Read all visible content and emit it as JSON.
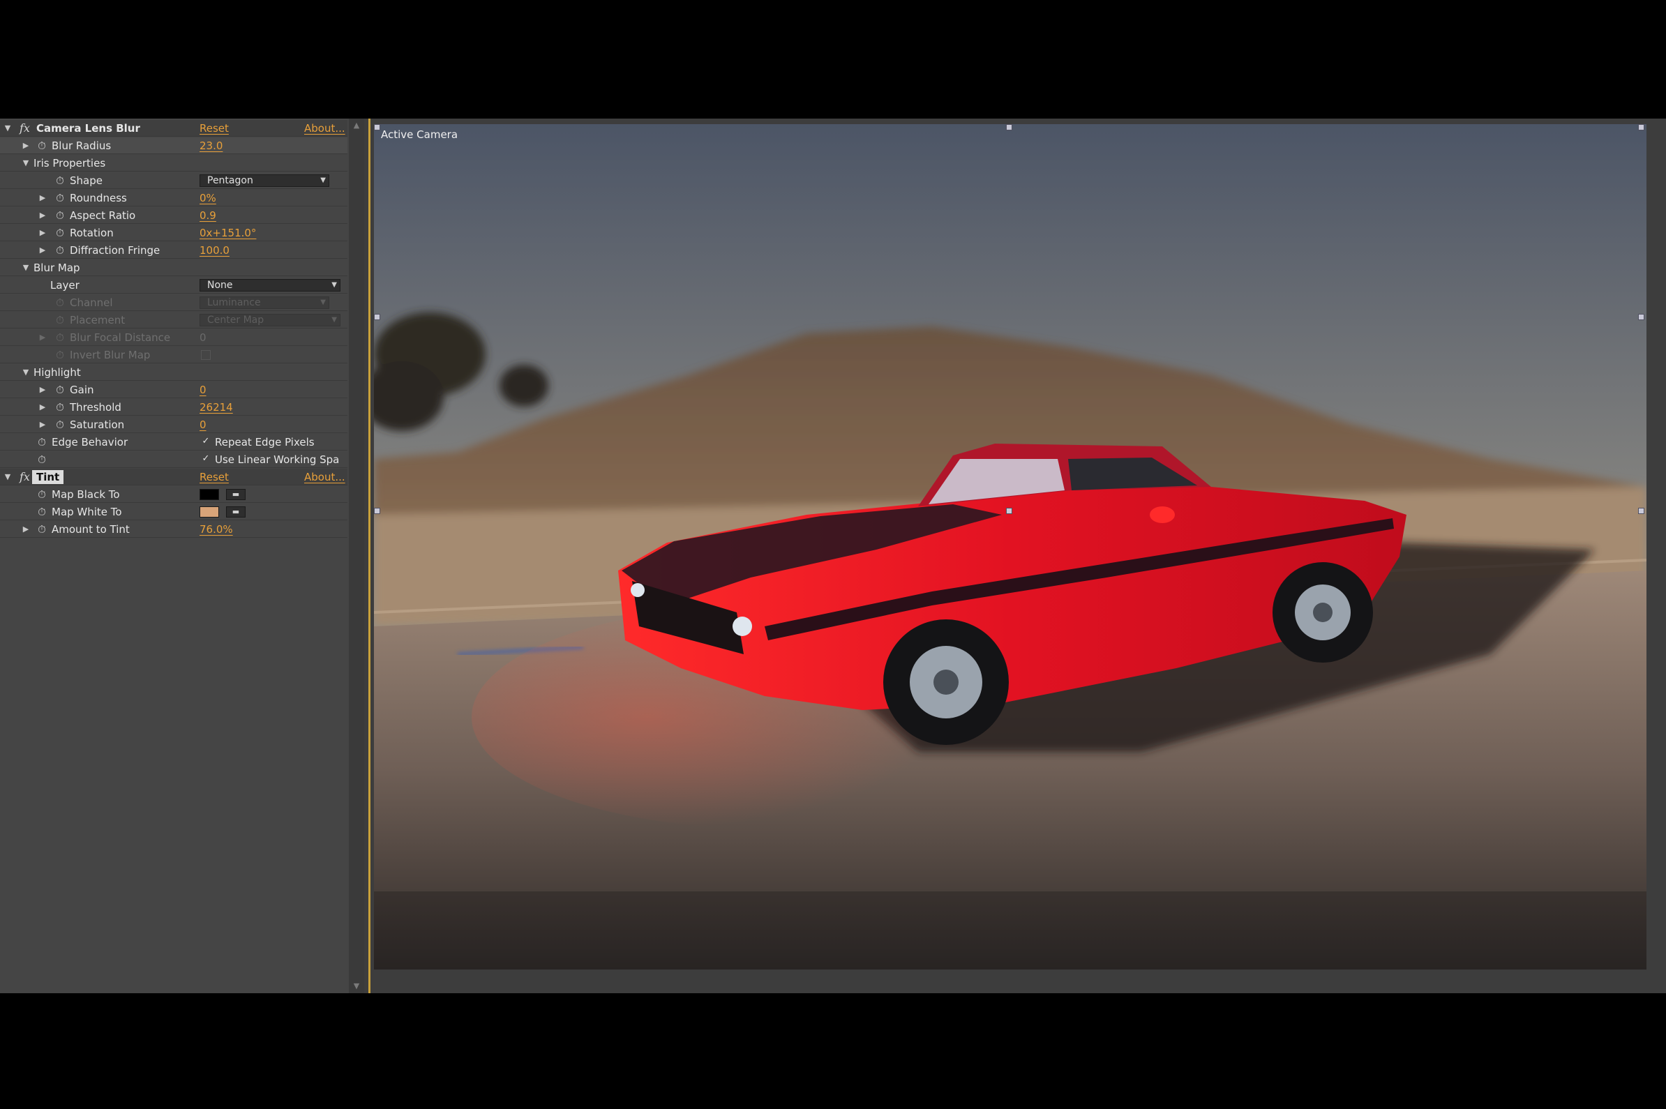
{
  "effects_panel": {
    "camera_lens_blur": {
      "fx_glyph": "fx",
      "name": "Camera Lens Blur",
      "reset": "Reset",
      "about": "About...",
      "blur_radius": {
        "label": "Blur Radius",
        "value": "23.0"
      },
      "iris_properties": {
        "label": "Iris Properties"
      },
      "shape": {
        "label": "Shape",
        "value": "Pentagon"
      },
      "roundness": {
        "label": "Roundness",
        "value": "0%"
      },
      "aspect_ratio": {
        "label": "Aspect Ratio",
        "value": "0.9"
      },
      "rotation": {
        "label": "Rotation",
        "value": "0x+151.0°"
      },
      "diffraction_fringe": {
        "label": "Diffraction Fringe",
        "value": "100.0"
      },
      "blur_map": {
        "label": "Blur Map"
      },
      "layer": {
        "label": "Layer",
        "value": "None"
      },
      "channel": {
        "label": "Channel",
        "value": "Luminance"
      },
      "placement": {
        "label": "Placement",
        "value": "Center Map"
      },
      "blur_focal_distance": {
        "label": "Blur Focal Distance",
        "value": "0"
      },
      "invert_blur_map": {
        "label": "Invert Blur Map"
      },
      "highlight": {
        "label": "Highlight"
      },
      "gain": {
        "label": "Gain",
        "value": "0"
      },
      "threshold": {
        "label": "Threshold",
        "value": "26214"
      },
      "saturation": {
        "label": "Saturation",
        "value": "0"
      },
      "edge_behavior": {
        "label": "Edge Behavior",
        "checkbox_label": "Repeat Edge Pixels",
        "checked": true
      },
      "linear_working": {
        "checkbox_label": "Use Linear Working Spa",
        "checked": true
      }
    },
    "tint": {
      "fx_glyph": "fx",
      "name": "Tint",
      "reset": "Reset",
      "about": "About...",
      "map_black_to": {
        "label": "Map Black To",
        "color": "#000000"
      },
      "map_white_to": {
        "label": "Map White To",
        "color": "#d8a479"
      },
      "amount_to_tint": {
        "label": "Amount to Tint",
        "value": "76.0%"
      }
    }
  },
  "viewer": {
    "label": "Active Camera",
    "accent_color": "#c9a13a",
    "image_description_icon": "red-muscle-car-photo"
  },
  "icons": {
    "stopwatch": "stopwatch-icon",
    "expand": "triangle-expand-icon",
    "collapse": "triangle-collapse-icon",
    "dropdown": "dropdown-arrow-icon",
    "eyedropper": "eyedropper-icon"
  }
}
